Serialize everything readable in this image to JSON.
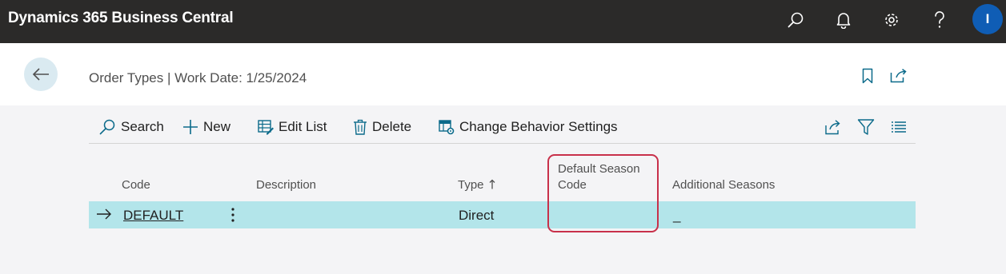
{
  "app": {
    "title": "Dynamics 365 Business Central",
    "user_initial": "I"
  },
  "header": {
    "page_title": "Order Types | Work Date: 1/25/2024"
  },
  "toolbar": {
    "search_label": "Search",
    "new_label": "New",
    "edit_list_label": "Edit List",
    "delete_label": "Delete",
    "change_behavior_label": "Change Behavior Settings"
  },
  "table": {
    "columns": {
      "code": "Code",
      "description": "Description",
      "type": "Type",
      "default_season_line1": "Default Season",
      "default_season_line2": "Code",
      "additional_seasons": "Additional Seasons"
    },
    "rows": [
      {
        "code": "DEFAULT",
        "description": "",
        "type": "Direct",
        "default_season_code": "",
        "additional_seasons": "_"
      }
    ]
  },
  "colors": {
    "topbar": "#2b2a29",
    "selected_row": "#b3e5ea",
    "highlight": "#c8304a",
    "avatar": "#0f5db5"
  }
}
